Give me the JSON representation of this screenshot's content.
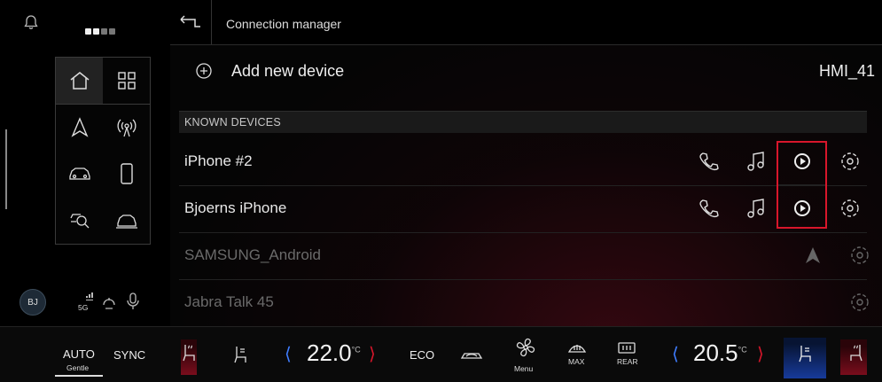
{
  "header": {
    "title": "Connection manager"
  },
  "add_device": {
    "label": "Add new device",
    "device_name": "HMI_41"
  },
  "section": {
    "known_devices": "KNOWN DEVICES"
  },
  "devices": [
    {
      "name": "iPhone #2",
      "state": "available",
      "icons": [
        "phone-icon",
        "music-icon",
        "carplay-icon",
        "settings-icon"
      ]
    },
    {
      "name": "Bjoerns iPhone",
      "state": "available",
      "icons": [
        "phone-icon",
        "music-icon",
        "carplay-icon",
        "settings-icon"
      ]
    },
    {
      "name": "SAMSUNG_Android",
      "state": "dimmed",
      "icons": [
        "android-auto-icon",
        "settings-icon"
      ]
    },
    {
      "name": "Jabra Talk 45",
      "state": "dimmed",
      "icons": [
        "settings-icon"
      ]
    }
  ],
  "profile": {
    "initials": "BJ"
  },
  "status": {
    "signal_label": "5G"
  },
  "climate": {
    "auto_label": "AUTO",
    "auto_sub": "Gentle",
    "sync_label": "SYNC",
    "left_temp": "22.0",
    "left_unit": "°C",
    "eco_label": "ECO",
    "menu_label": "Menu",
    "max_label": "MAX",
    "rear_label": "REAR",
    "right_temp": "20.5",
    "right_unit": "°C"
  },
  "colors": {
    "accent_blue": "#3f7dff",
    "accent_red": "#d8162b",
    "highlight_box": "#d8162b"
  }
}
